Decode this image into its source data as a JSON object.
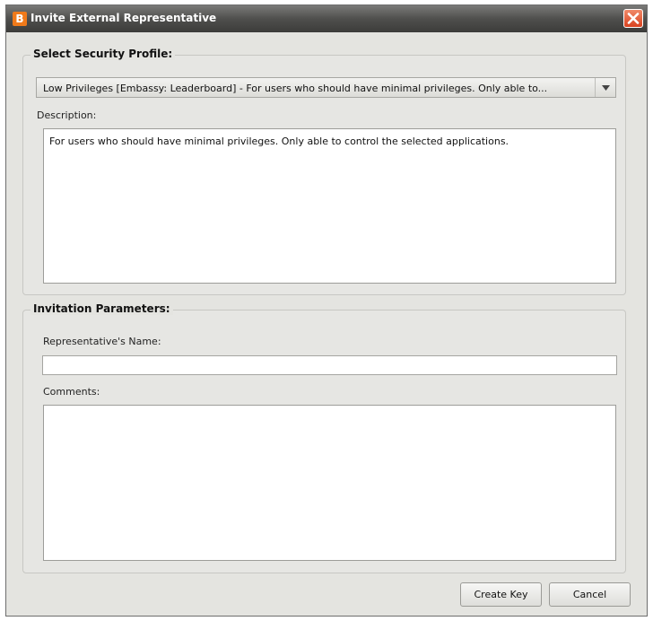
{
  "window": {
    "title": "Invite External Representative",
    "app_icon_letter": "B",
    "accent_color": "#f07a1a"
  },
  "security_profile": {
    "legend": "Select Security Profile:",
    "selected_profile": "Low Privileges [Embassy: Leaderboard] - For users who should have minimal privileges. Only able to...",
    "description_label": "Description:",
    "description_text": "For users who should have minimal privileges. Only able to control the selected applications."
  },
  "invitation": {
    "legend": "Invitation Parameters:",
    "name_label": "Representative's Name:",
    "name_value": "",
    "comments_label": "Comments:",
    "comments_value": ""
  },
  "buttons": {
    "create_key": "Create Key",
    "cancel": "Cancel"
  }
}
